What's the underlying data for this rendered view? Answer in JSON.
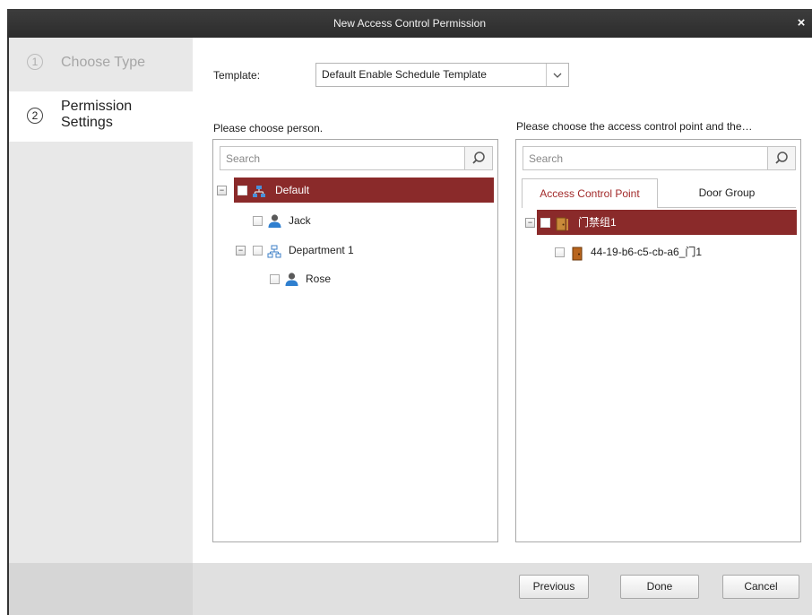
{
  "window": {
    "title": "New Access Control Permission",
    "close_glyph": "×"
  },
  "steps": [
    {
      "number": "1",
      "label": "Choose Type",
      "active": false
    },
    {
      "number": "2",
      "label": "Permission Settings",
      "active": true
    }
  ],
  "template": {
    "label": "Template:",
    "value": "Default Enable Schedule Template",
    "arrow_glyph": "⌄"
  },
  "person_panel": {
    "label": "Please choose person.",
    "search_placeholder": "Search",
    "tree": [
      {
        "label": "Default",
        "type": "organization",
        "selected": true,
        "expander": "−"
      },
      {
        "label": "Jack",
        "type": "person"
      },
      {
        "label": "Department 1",
        "type": "organization",
        "expander": "−"
      },
      {
        "label": "Rose",
        "type": "person"
      }
    ]
  },
  "acp_panel": {
    "label": "Please choose the access control point and the…",
    "search_placeholder": "Search",
    "tabs": [
      "Access Control Point",
      "Door Group"
    ],
    "tree": [
      {
        "label": "门禁组1",
        "type": "door-group",
        "selected": true,
        "expander": "−"
      },
      {
        "label": "44-19-b6-c5-cb-a6_门1",
        "type": "door"
      }
    ]
  },
  "footer": {
    "previous": "Previous",
    "done": "Done",
    "cancel": "Cancel"
  },
  "colors": {
    "accent": "#8a2a2a",
    "tab_active_text": "#a22a2a",
    "titlebar": "#333333"
  }
}
